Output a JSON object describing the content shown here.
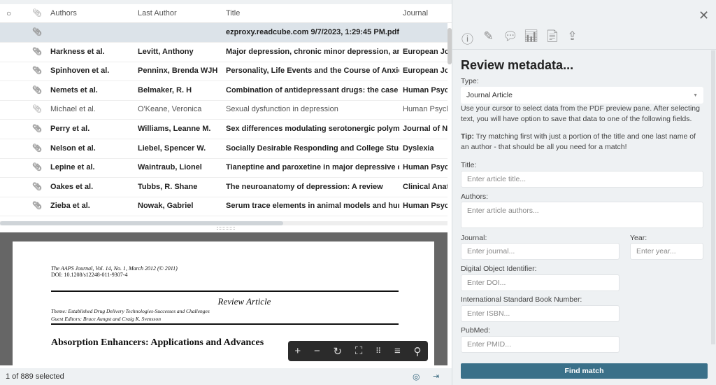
{
  "table": {
    "headers": {
      "authors": "Authors",
      "last_author": "Last Author",
      "title": "Title",
      "journal": "Journal"
    },
    "rows": [
      {
        "authors": "",
        "last_author": "",
        "title": "ezproxy.readcube.com 9/7/2023, 1:29:45 PM.pdf",
        "journal": ""
      },
      {
        "authors": "Harkness et al.",
        "last_author": "Levitt, Anthony",
        "title": "Major depression, chronic minor depression, and...",
        "journal": "European Jou"
      },
      {
        "authors": "Spinhoven et al.",
        "last_author": "Penninx, Brenda WJH",
        "title": "Personality, Life Events and the Course of Anxiet...",
        "journal": "European Jou"
      },
      {
        "authors": "Nemets et al.",
        "last_author": "Belmaker, R. H",
        "title": "Combination of antidepressant drugs: the case o...",
        "journal": "Human Psych"
      },
      {
        "authors": "Michael et al.",
        "last_author": "O'Keane, Veronica",
        "title": "Sexual dysfunction in depression",
        "journal": "Human Psych"
      },
      {
        "authors": "Perry et al.",
        "last_author": "Williams, Leanne M.",
        "title": "Sex differences modulating serotonergic polymo...",
        "journal": "Journal of Ne"
      },
      {
        "authors": "Nelson et al.",
        "last_author": "Liebel, Spencer W.",
        "title": "Socially Desirable Responding and College Stude...",
        "journal": "Dyslexia"
      },
      {
        "authors": "Lepine et al.",
        "last_author": "Waintraub, Lionel",
        "title": "Tianeptine and paroxetine in major depressive di...",
        "journal": "Human Psych"
      },
      {
        "authors": "Oakes et al.",
        "last_author": "Tubbs, R. Shane",
        "title": "The neuroanatomy of depression: A review",
        "journal": "Clinical Anato"
      },
      {
        "authors": "Zieba et al.",
        "last_author": "Nowak, Gabriel",
        "title": "Serum trace elements in animal models and hum...",
        "journal": "Human Psych"
      }
    ]
  },
  "pdf": {
    "citation": "The AAPS Journal, Vol. 14, No. 1, March 2012 (© 2011)",
    "doi": "DOI: 10.1208/s12248-011-9307-4",
    "kind": "Review Article",
    "theme": "Theme: Established Drug Delivery Technologies-Successes and Challenges",
    "editors": "Guest Editors: Bruce Aungst and Craig K. Svensson",
    "title": "Absorption Enhancers: Applications and Advances"
  },
  "status": {
    "selected": "1 of 889 selected"
  },
  "panel": {
    "heading": "Review metadata...",
    "type_label": "Type:",
    "type_value": "Journal Article",
    "help": "Use your cursor to select data from the PDF preview pane. After selecting text, you will have option to save that data to one of the following fields.",
    "tip_bold": "Tip:",
    "tip": " Try matching first with just a portion of the title and one last name of an author - that should be all you need for a match!",
    "title_label": "Title:",
    "title_ph": "Enter article title...",
    "authors_label": "Authors:",
    "authors_ph": "Enter article authors...",
    "journal_label": "Journal:",
    "journal_ph": "Enter journal...",
    "year_label": "Year:",
    "year_ph": "Enter year...",
    "doi_label": "Digital Object Identifier:",
    "doi_ph": "Enter DOI...",
    "isbn_label": "International Standard Book Number:",
    "isbn_ph": "Enter ISBN...",
    "pubmed_label": "PubMed:",
    "pubmed_ph": "Enter PMID...",
    "find": "Find match"
  }
}
